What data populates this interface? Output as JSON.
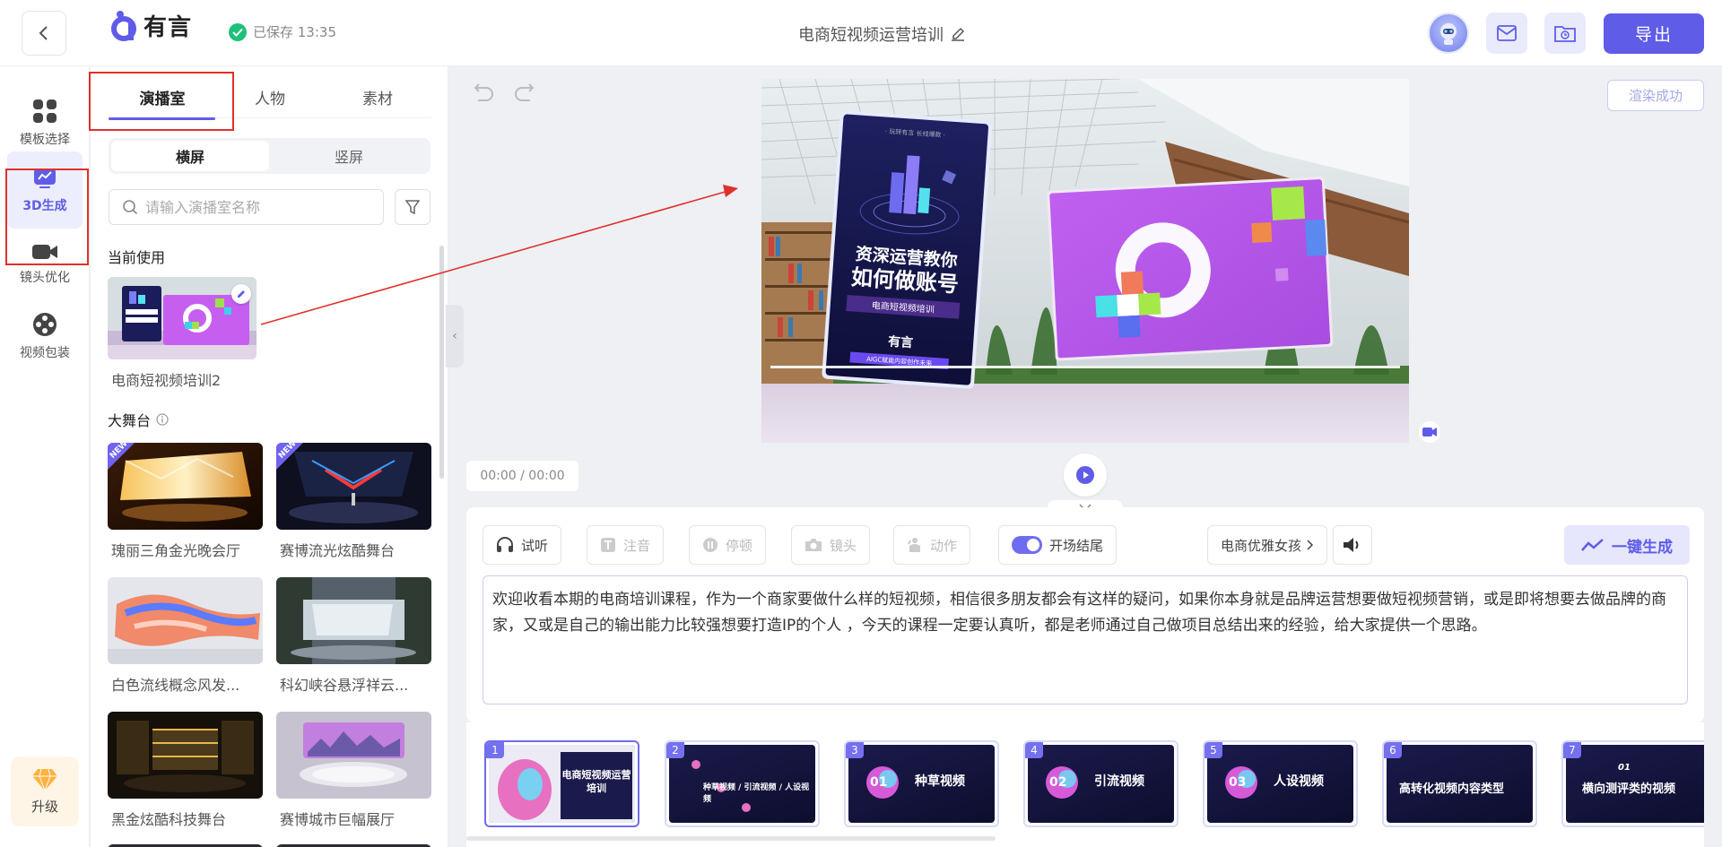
{
  "header": {
    "logo_text": "有言",
    "saved_text": "已保存 13:35",
    "doc_title": "电商短视频运营培训",
    "export_label": "导出"
  },
  "leftnav": {
    "items": [
      {
        "label": "模板选择",
        "icon": "grid-icon"
      },
      {
        "label": "3D生成",
        "icon": "monitor-chart-icon",
        "active": true
      },
      {
        "label": "镜头优化",
        "icon": "video-camera-icon"
      },
      {
        "label": "视频包装",
        "icon": "film-reel-icon"
      }
    ],
    "upgrade_label": "升级"
  },
  "panel": {
    "tabs": [
      "演播室",
      "人物",
      "素材"
    ],
    "active_tab": 0,
    "orientation": [
      "横屏",
      "竖屏"
    ],
    "search_placeholder": "请输入演播室名称",
    "current_section": "当前使用",
    "current_item": "电商短视频培训2",
    "stage_section": "大舞台",
    "stages": [
      {
        "name": "瑰丽三角金光晚会厅",
        "new": true
      },
      {
        "name": "赛博流光炫酷舞台",
        "new": true
      },
      {
        "name": "白色流线概念风发...",
        "new": false
      },
      {
        "name": "科幻峡谷悬浮祥云...",
        "new": false
      },
      {
        "name": "黑金炫酷科技舞台",
        "new": false
      },
      {
        "name": "赛博城市巨幅展厅",
        "new": false
      }
    ],
    "new_badge": "NEW"
  },
  "preview": {
    "render_status": "渲染成功",
    "time": "00:00 / 00:00",
    "poster_tagline": "· 玩转有言 长线爆款 ·",
    "poster_title_1": "资深运营教你",
    "poster_title_2": "如何做账号",
    "poster_subtitle": "电商短视频培训",
    "poster_brand": "有言",
    "poster_footer": "AIGC赋能内容创作未来"
  },
  "editor": {
    "tools": [
      "试听",
      "注音",
      "停顿",
      "镜头",
      "动作"
    ],
    "toggle_label": "开场结尾",
    "voice": "电商优雅女孩",
    "generate_label": "一键生成",
    "script": "欢迎收看本期的电商培训课程，作为一个商家要做什么样的短视频，相信很多朋友都会有这样的疑问，如果你本身就是品牌运营想要做短视频营销，或是即将想要去做品牌的商家，又或是自己的输出能力比较强想要打造IP的个人 ，今天的课程一定要认真听，都是老师通过自己做项目总结出来的经验，给大家提供一个思路。"
  },
  "scenes": [
    {
      "num": "1",
      "title": "电商短视频运营培训"
    },
    {
      "num": "2",
      "title": "种草视频 / 引流视频 / 人设视频"
    },
    {
      "num": "3",
      "title": "种草视频",
      "badge": "01"
    },
    {
      "num": "4",
      "title": "引流视频",
      "badge": "02"
    },
    {
      "num": "5",
      "title": "人设视频",
      "badge": "03"
    },
    {
      "num": "6",
      "title": "高转化视频内容类型"
    },
    {
      "num": "7",
      "title": "横向测评类的视频",
      "badge": "01"
    }
  ],
  "colors": {
    "accent": "#5f5ce8",
    "annotation_red": "#e0302b",
    "saved_green": "#1dc17a"
  }
}
